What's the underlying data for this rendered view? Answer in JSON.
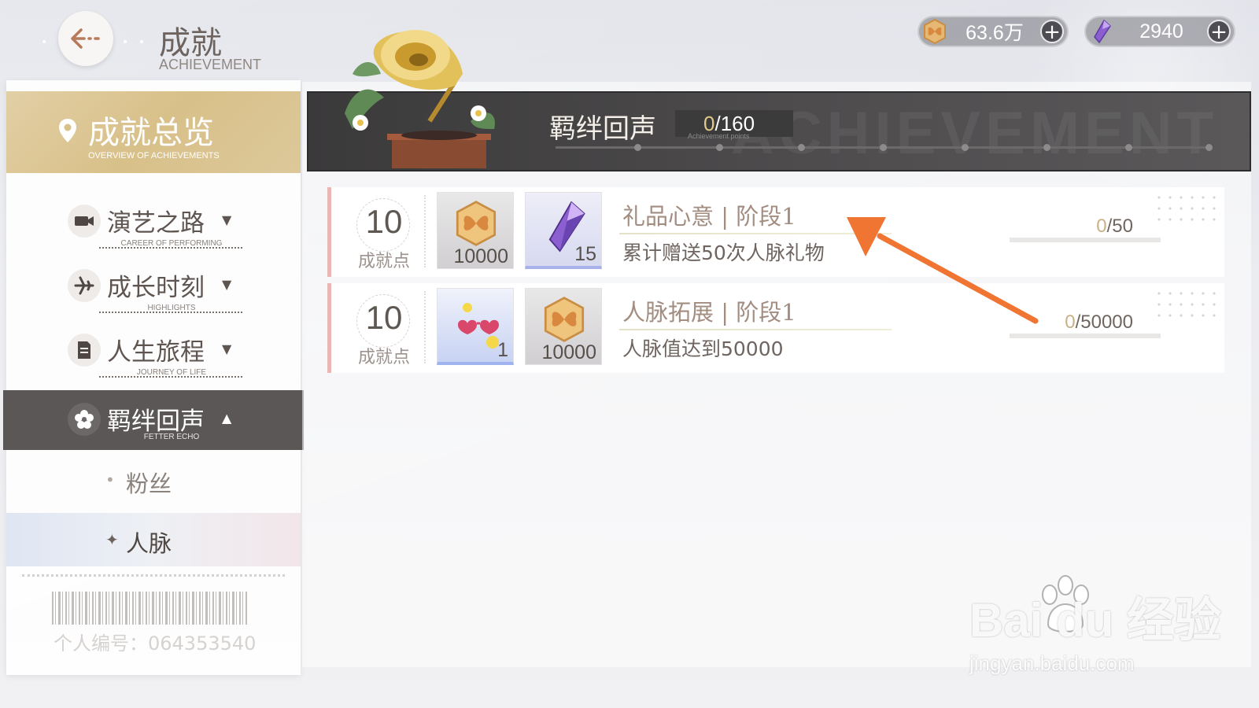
{
  "header": {
    "title": "成就",
    "subtitle": "ACHIEVEMENT",
    "back_icon": "arrow-left-icon"
  },
  "currencies": [
    {
      "name": "gold-coin",
      "value": "63.6万",
      "icon": "butterfly-coin-icon"
    },
    {
      "name": "crystal",
      "value": "2940",
      "icon": "purple-crystal-icon"
    }
  ],
  "sidebar": {
    "overview": {
      "label": "成就总览",
      "sub": "OVERVIEW OF ACHIEVEMENTS"
    },
    "items": [
      {
        "label": "演艺之路",
        "sub": "CAREER OF PERFORMING",
        "icon": "camera-icon"
      },
      {
        "label": "成长时刻",
        "sub": "HIGHLIGHTS",
        "icon": "airplane-icon"
      },
      {
        "label": "人生旅程",
        "sub": "JOURNEY OF LIFE",
        "icon": "document-icon"
      },
      {
        "label": "羁绊回声",
        "sub": "FETTER ECHO",
        "icon": "flower-icon",
        "active": true
      }
    ],
    "subitems": [
      {
        "label": "粉丝",
        "active": false
      },
      {
        "label": "人脉",
        "active": true
      }
    ],
    "player_id": "个人编号：064353540"
  },
  "banner": {
    "title": "羁绊回声",
    "points_current": "0",
    "points_total": "/160",
    "points_sub": "Achievement points",
    "watermark": "ACHIEVEMENT"
  },
  "achievements": [
    {
      "points": "10",
      "points_label": "成就点",
      "rewards": [
        {
          "icon": "butterfly-coin-icon",
          "qty": "10000",
          "rarity": "gray"
        },
        {
          "icon": "purple-crystal-icon",
          "qty": "15",
          "rarity": "purple"
        }
      ],
      "title": "礼品心意 | 阶段1",
      "desc": "累计赠送50次人脉礼物",
      "progress_current": "0",
      "progress_total": "/50",
      "progress_fraction": 0
    },
    {
      "points": "10",
      "points_label": "成就点",
      "rewards": [
        {
          "icon": "heart-sunglasses-icon",
          "qty": "1",
          "rarity": "blue"
        },
        {
          "icon": "butterfly-coin-icon",
          "qty": "10000",
          "rarity": "gray"
        }
      ],
      "title": "人脉拓展 | 阶段1",
      "desc": "人脉值达到50000",
      "progress_current": "0",
      "progress_total": "/50000",
      "progress_fraction": 0
    }
  ],
  "watermark": {
    "brand": "Bai du 经验",
    "url": "jingyan.baidu.com"
  },
  "colors": {
    "accent_gold": "#d8c089",
    "active_nav": "#5a5756",
    "annotation_arrow": "#f07432"
  }
}
